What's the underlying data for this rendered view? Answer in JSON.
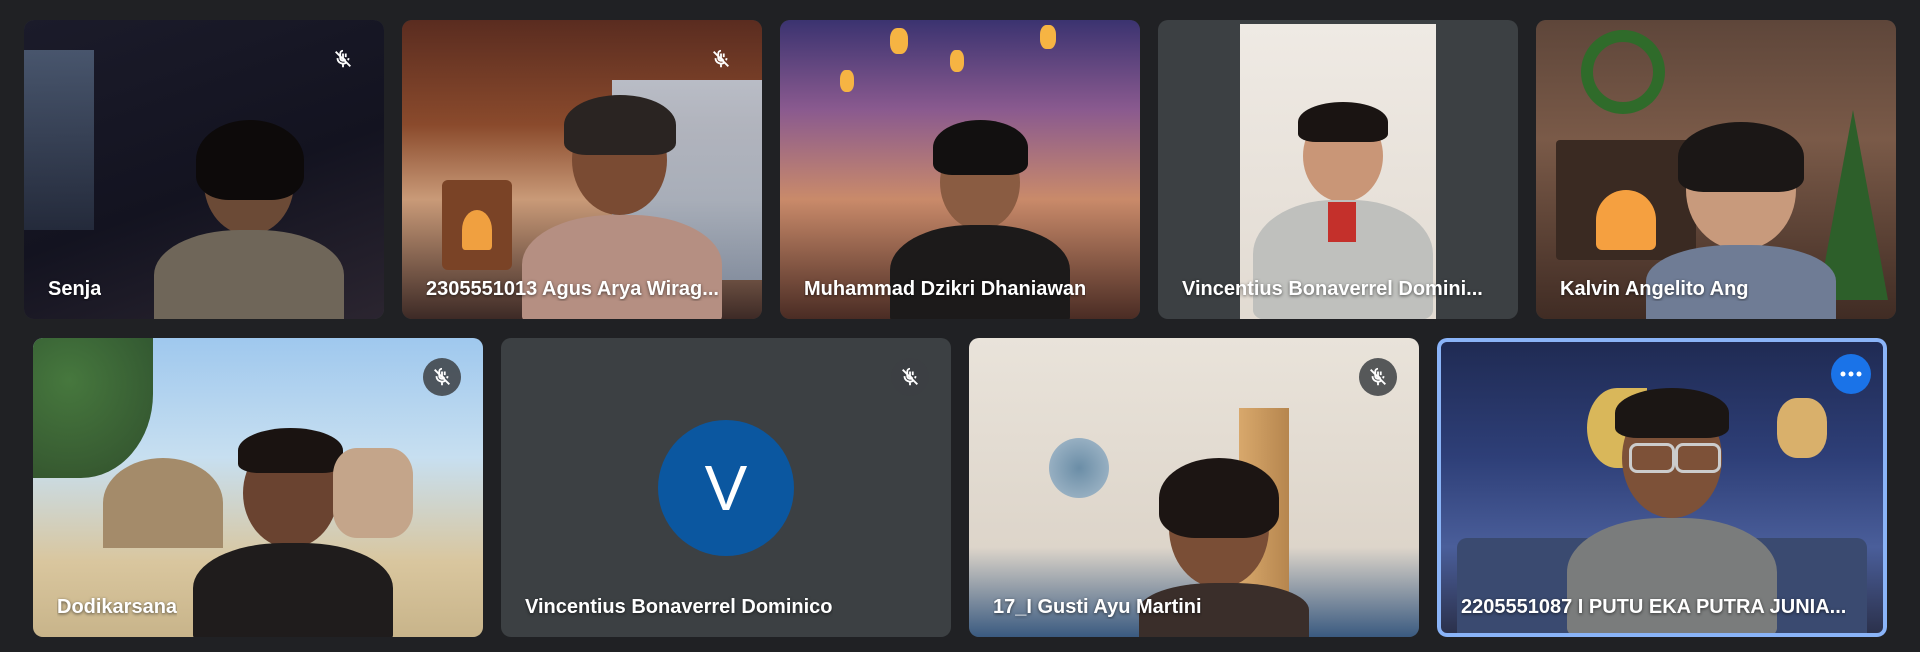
{
  "meeting": {
    "row1": [
      {
        "name": "Senja",
        "muted": true
      },
      {
        "name": "2305551013 Agus Arya Wirag...",
        "muted": true
      },
      {
        "name": "Muhammad Dzikri Dhaniawan",
        "muted": false
      },
      {
        "name": "Vincentius Bonaverrel Domini...",
        "muted": false
      },
      {
        "name": "Kalvin Angelito Ang",
        "muted": false
      }
    ],
    "row2": [
      {
        "name": "Dodikarsana",
        "muted": true
      },
      {
        "name": "Vincentius Bonaverrel Dominico",
        "muted": true,
        "avatar_letter": "V"
      },
      {
        "name": "17_I Gusti Ayu Martini",
        "muted": true
      },
      {
        "name": "2205551087 I PUTU EKA PUTRA JUNIA...",
        "muted": false,
        "selected": true
      }
    ]
  },
  "icons": {
    "muted": "mic-off-icon",
    "more": "more-options-icon"
  },
  "colors": {
    "background": "#202124",
    "tile": "#3c4043",
    "avatar": "#0b57a0",
    "highlight": "#8ab4f8",
    "more_button": "#1a73e8"
  }
}
